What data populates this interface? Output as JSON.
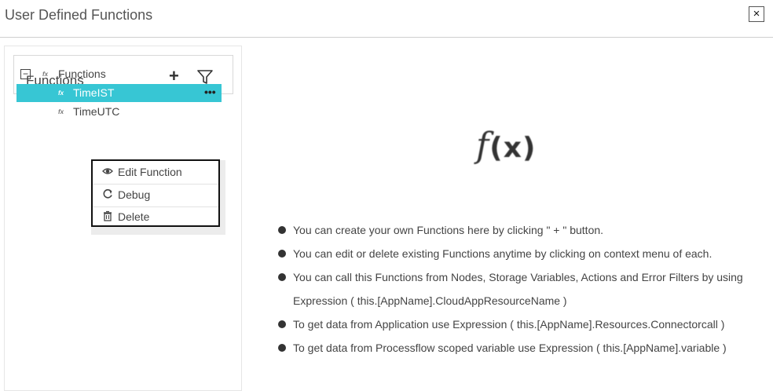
{
  "window": {
    "title": "User Defined Functions",
    "close_label": "×"
  },
  "panel": {
    "header_title": "Functions",
    "add_label": "+",
    "tree": {
      "root_label": "Functions",
      "root_expander": "−",
      "items": [
        {
          "label": "TimeIST",
          "selected": true,
          "more_label": "•••"
        },
        {
          "label": "TimeUTC",
          "selected": false
        }
      ]
    }
  },
  "context_menu": {
    "items": [
      {
        "label": "Edit Function",
        "icon": "eye-icon"
      },
      {
        "label": "Debug",
        "icon": "refresh-icon"
      },
      {
        "label": "Delete",
        "icon": "trash-icon"
      }
    ]
  },
  "main": {
    "fx_glyph": "f",
    "fx_args": "(x)",
    "info": [
      "You can create your own Functions here by clicking \" + \" button.",
      "You can edit or delete existing Functions anytime by clicking on context menu of each.",
      "You can call this Functions from Nodes, Storage Variables, Actions and Error Filters by using Expression ( this.[AppName].CloudAppResourceName )",
      "To get data from Application use Expression ( this.[AppName].Resources.Connectorcall )",
      "To get data from Processflow scoped variable use Expression ( this.[AppName].variable )"
    ]
  },
  "colors": {
    "selected_bg": "#37c6d4",
    "menu_border": "#111111"
  }
}
